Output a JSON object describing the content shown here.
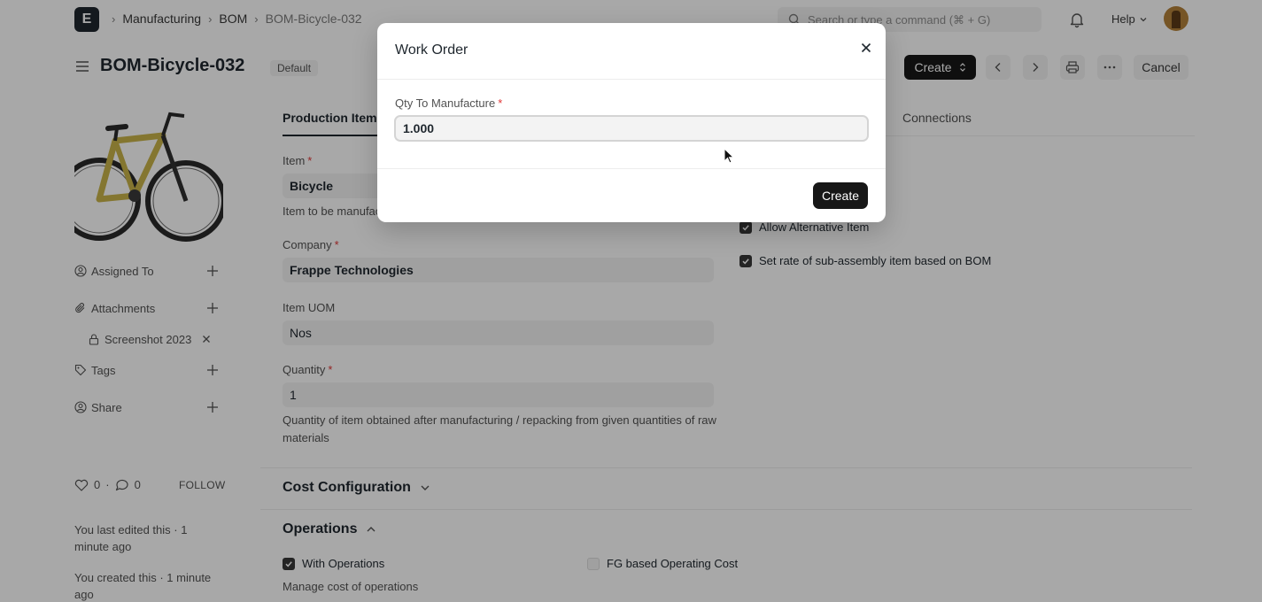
{
  "navbar": {
    "logo_letter": "E",
    "breadcrumbs": [
      "Manufacturing",
      "BOM",
      "BOM-Bicycle-032"
    ],
    "search_placeholder": "Search or type a command (⌘ + G)",
    "help_label": "Help"
  },
  "page": {
    "title": "BOM-Bicycle-032",
    "status_indicator": "Default",
    "create_label": "Create",
    "cancel_label": "Cancel"
  },
  "sidebar": {
    "assigned_to": "Assigned To",
    "attachments": "Attachments",
    "attachment_file": "Screenshot 2023",
    "tags": "Tags",
    "share": "Share",
    "likes_count": "0",
    "comments_count": "0",
    "follow_label": "FOLLOW",
    "last_edited": "You last edited this · 1 minute ago",
    "created": "You created this · 1 minute ago"
  },
  "tabs": {
    "production_item": "Production Item",
    "connections": "Connections"
  },
  "form": {
    "item_label": "Item",
    "item_value": "Bicycle",
    "item_desc": "Item to be manufactured or repacked",
    "company_label": "Company",
    "company_value": "Frappe Technologies",
    "uom_label": "Item UOM",
    "uom_value": "Nos",
    "quantity_label": "Quantity",
    "quantity_value": "1",
    "quantity_desc": "Quantity of item obtained after manufacturing / repacking from given quantities of raw materials",
    "allow_alternative": "Allow Alternative Item",
    "set_rate_subassembly": "Set rate of sub-assembly item based on BOM",
    "cost_configuration": "Cost Configuration",
    "operations": "Operations",
    "with_operations": "With Operations",
    "fg_operating_cost": "FG based Operating Cost",
    "operations_desc": "Manage cost of operations"
  },
  "modal": {
    "title": "Work Order",
    "qty_label": "Qty To Manufacture",
    "qty_value": "1.000",
    "create_label": "Create"
  }
}
